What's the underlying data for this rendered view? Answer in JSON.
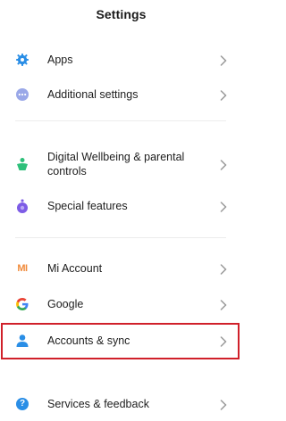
{
  "header": {
    "title": "Settings"
  },
  "items": [
    {
      "id": "apps",
      "label": "Apps",
      "icon": "apps-gear-icon"
    },
    {
      "id": "additional",
      "label": "Additional settings",
      "icon": "more-dots-icon"
    },
    {
      "id": "wellbeing",
      "label": "Digital Wellbeing & parental controls",
      "icon": "wellbeing-person-icon"
    },
    {
      "id": "special",
      "label": "Special features",
      "icon": "special-features-icon"
    },
    {
      "id": "mi",
      "label": "Mi Account",
      "icon": "mi-logo-icon",
      "icon_text": "MI"
    },
    {
      "id": "google",
      "label": "Google",
      "icon": "google-logo-icon",
      "icon_text": "G"
    },
    {
      "id": "accounts",
      "label": "Accounts & sync",
      "icon": "account-person-icon"
    },
    {
      "id": "services",
      "label": "Services & feedback",
      "icon": "help-question-icon",
      "icon_text": "?"
    }
  ],
  "colors": {
    "blue": "#2a8ee6",
    "green": "#2ec07a",
    "purple": "#7d5ce6",
    "orange": "#f08a3a",
    "highlight": "#d0202a",
    "google_blue": "#4285f4"
  }
}
